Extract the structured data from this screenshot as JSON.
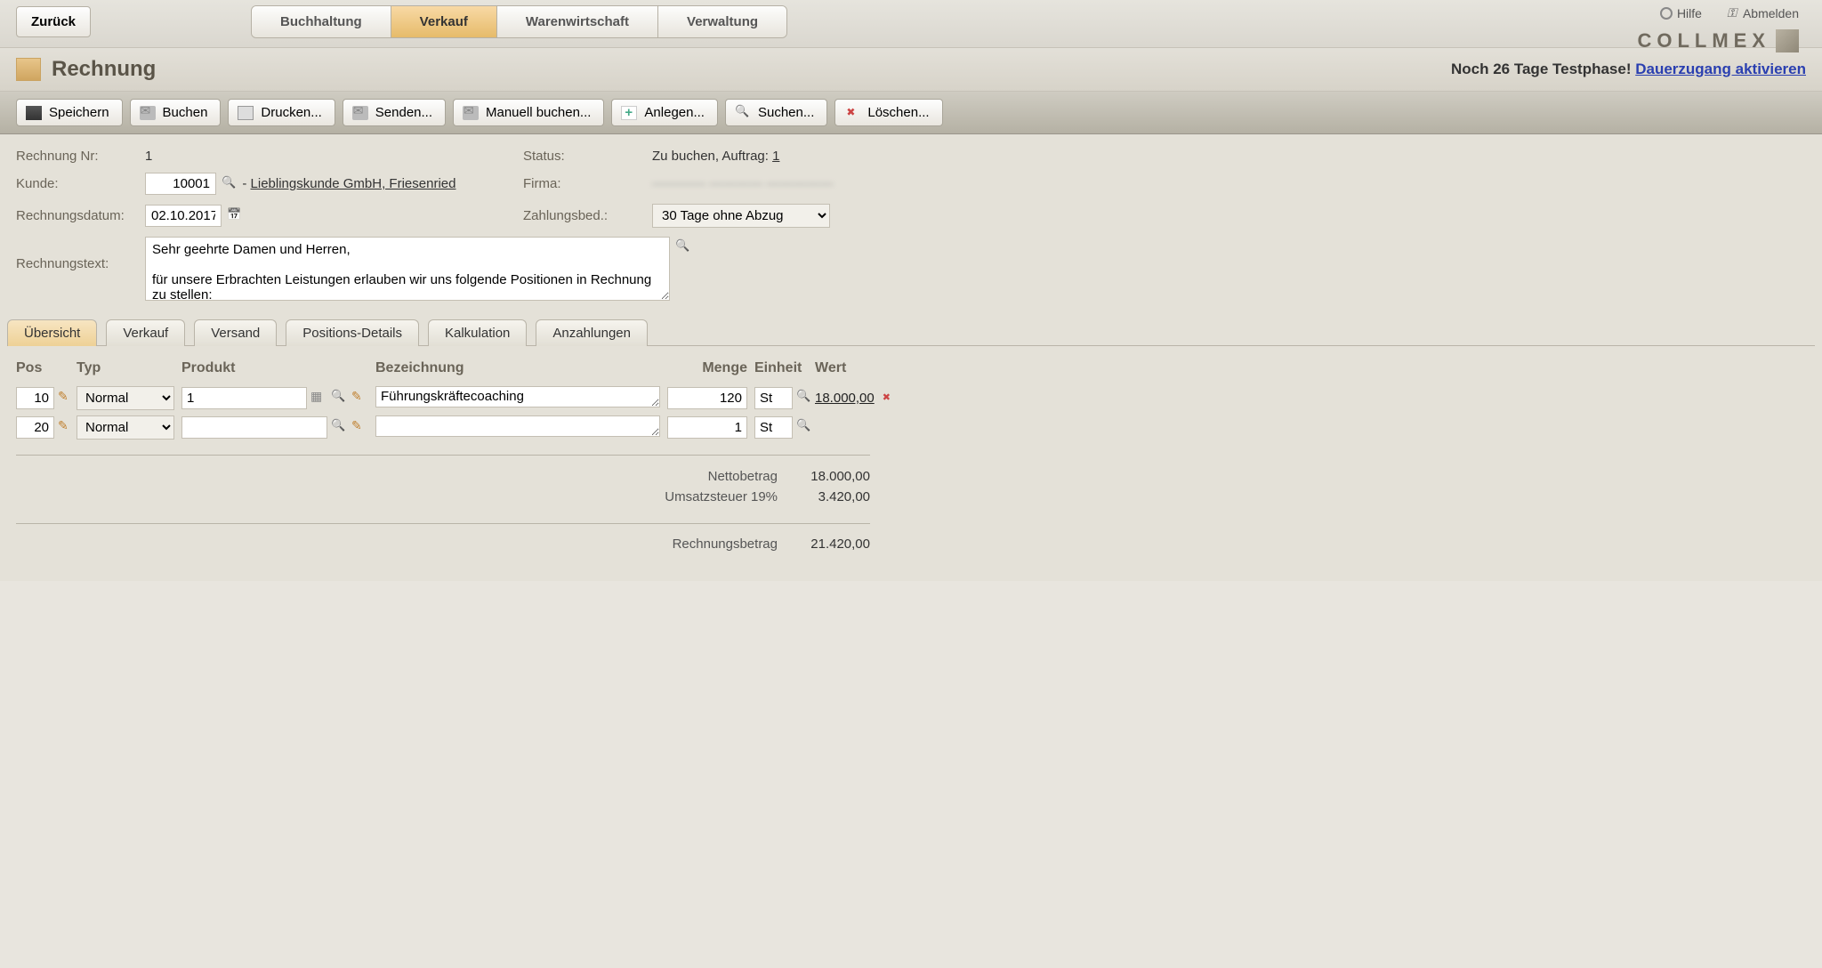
{
  "top": {
    "back": "Zurück",
    "tabs": {
      "t1": "Buchhaltung",
      "t2": "Verkauf",
      "t3": "Warenwirtschaft",
      "t4": "Verwaltung"
    },
    "help": "Hilfe",
    "logout": "Abmelden",
    "brand": "COLLMEX"
  },
  "title": {
    "page": "Rechnung",
    "trial_prefix": "Noch 26 Tage Testphase! ",
    "trial_link": "Dauerzugang aktivieren"
  },
  "toolbar": {
    "save": "Speichern",
    "book": "Buchen",
    "print": "Drucken...",
    "send": "Senden...",
    "manual": "Manuell buchen...",
    "new": "Anlegen...",
    "search": "Suchen...",
    "delete": "Löschen..."
  },
  "form": {
    "labels": {
      "nr": "Rechnung Nr:",
      "kunde": "Kunde:",
      "datum": "Rechnungsdatum:",
      "status": "Status:",
      "firma": "Firma:",
      "zb": "Zahlungsbed.:",
      "text": "Rechnungstext:"
    },
    "nr": "1",
    "kunde_nr": "10001",
    "kunde_name": "Lieblingskunde GmbH, Friesenried",
    "kunde_sep": " - ",
    "datum": "02.10.2017",
    "status_text": "Zu buchen, Auftrag: ",
    "auftrag_link": "1",
    "firma": "———— ———— —————",
    "zb": "30 Tage ohne Abzug",
    "text": "Sehr geehrte Damen und Herren,\n\nfür unsere Erbrachten Leistungen erlauben wir uns folgende Positionen in Rechnung zu stellen:"
  },
  "subtabs": {
    "t1": "Übersicht",
    "t2": "Verkauf",
    "t3": "Versand",
    "t4": "Positions-Details",
    "t5": "Kalkulation",
    "t6": "Anzahlungen"
  },
  "grid": {
    "head": {
      "pos": "Pos",
      "typ": "Typ",
      "produkt": "Produkt",
      "bez": "Bezeichnung",
      "menge": "Menge",
      "einheit": "Einheit",
      "wert": "Wert"
    },
    "typ_option": "Normal",
    "rows": [
      {
        "pos": "10",
        "produkt": "1",
        "bez": "Führungskräftecoaching",
        "menge": "120",
        "einheit": "St",
        "wert": "18.000,00"
      },
      {
        "pos": "20",
        "produkt": "",
        "bez": "",
        "menge": "1",
        "einheit": "St",
        "wert": ""
      }
    ]
  },
  "totals": {
    "netto_label": "Nettobetrag",
    "netto": "18.000,00",
    "ust_label": "Umsatzsteuer 19%",
    "ust": "3.420,00",
    "sum_label": "Rechnungsbetrag",
    "sum": "21.420,00"
  }
}
